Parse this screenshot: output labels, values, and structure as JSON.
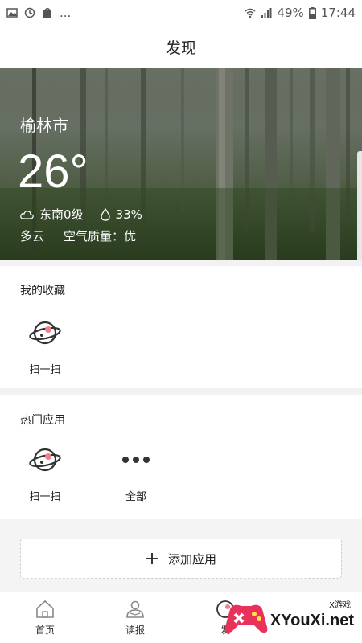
{
  "status_bar": {
    "more": "...",
    "battery": "49%",
    "time": "17:44"
  },
  "header": {
    "title": "发现"
  },
  "weather": {
    "city": "榆林市",
    "temperature": "26°",
    "wind": "东南0级",
    "humidity": "33%",
    "condition": "多云",
    "air_quality": "空气质量：优"
  },
  "favorites": {
    "title": "我的收藏",
    "items": [
      {
        "label": "扫一扫",
        "icon": "planet-icon"
      }
    ]
  },
  "hot_apps": {
    "title": "热门应用",
    "items": [
      {
        "label": "扫一扫",
        "icon": "planet-icon"
      },
      {
        "label": "全部",
        "icon": "more-dots-icon"
      }
    ]
  },
  "add_app": {
    "label": "添加应用"
  },
  "tabbar": {
    "items": [
      {
        "label": "首页",
        "icon": "home-icon"
      },
      {
        "label": "读报",
        "icon": "reader-icon"
      },
      {
        "label": "发",
        "icon": "discover-icon"
      }
    ]
  },
  "watermark": {
    "small": "X游戏",
    "text": "XYouXi.net"
  }
}
